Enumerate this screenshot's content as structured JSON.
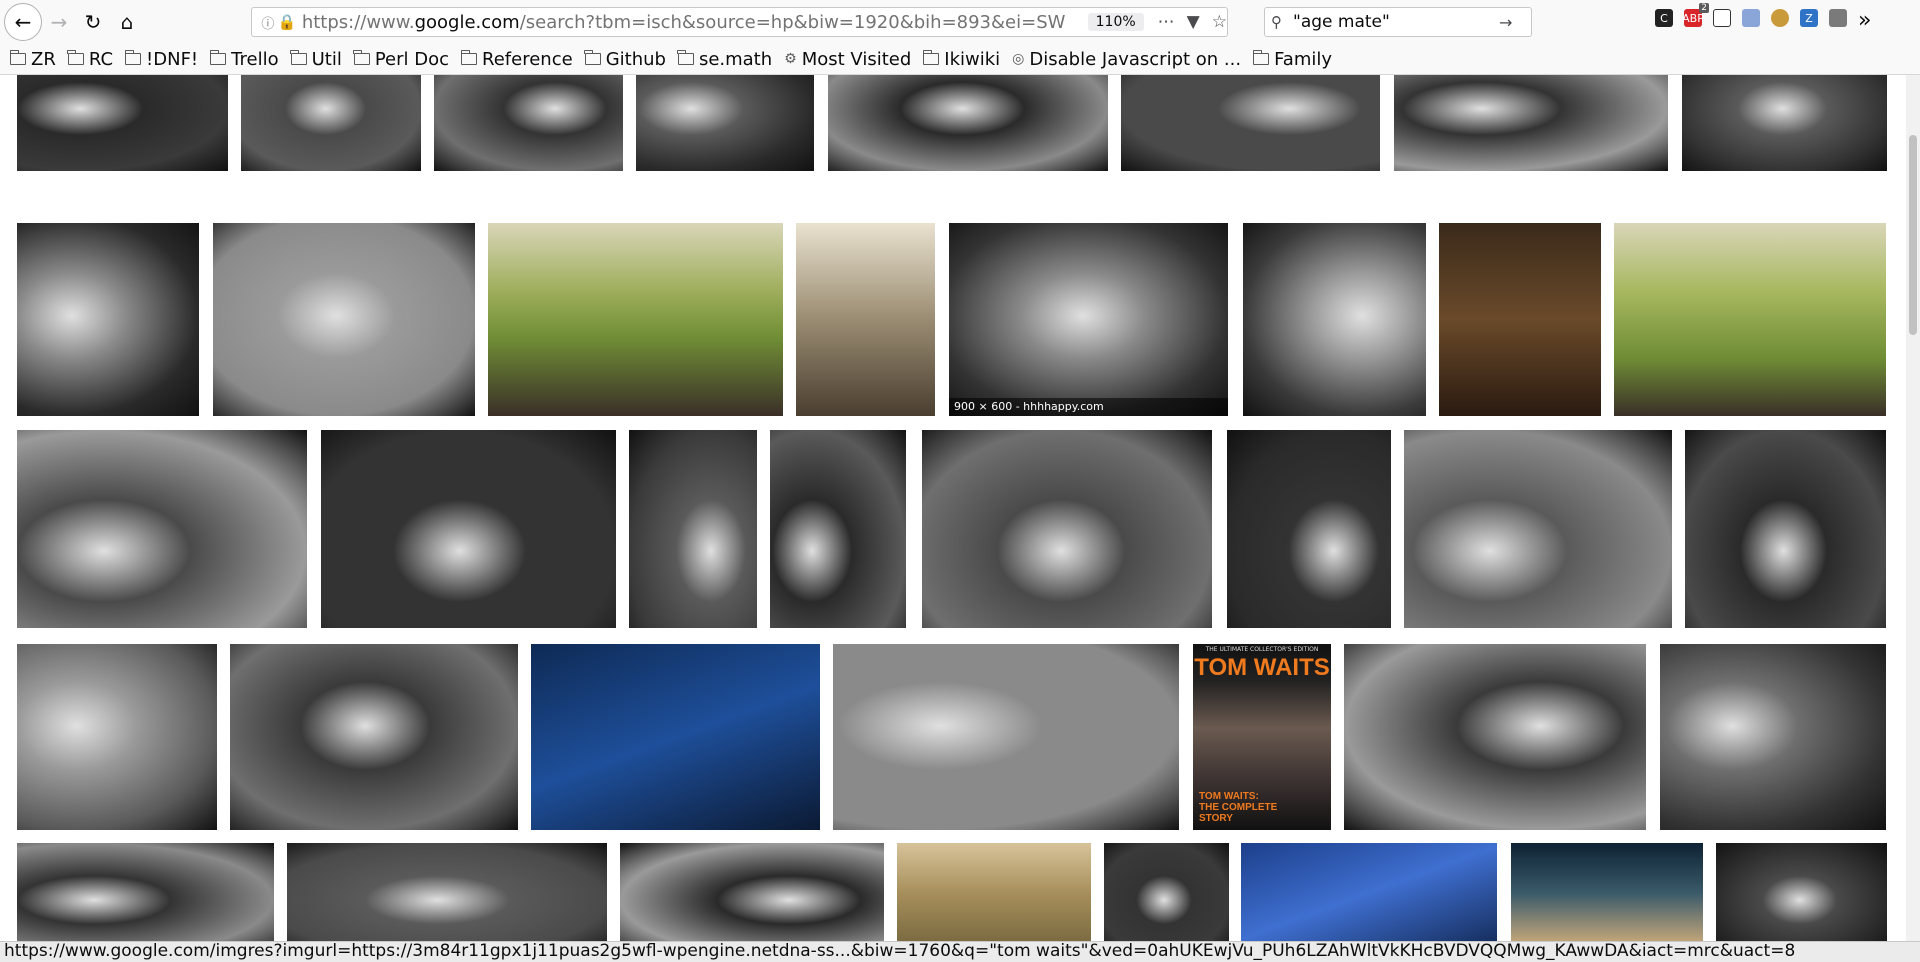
{
  "browser": {
    "url_scheme": "https://www.",
    "url_host": "google.com",
    "url_path": "/search?tbm=isch&source=hp&biw=1920&bih=893&ei=SW",
    "zoom": "110%",
    "search_query": "\"age mate\"",
    "extension_badge": "2"
  },
  "bookmarks": [
    {
      "label": "ZR",
      "icon": "folder-icon"
    },
    {
      "label": "RC",
      "icon": "folder-icon"
    },
    {
      "label": "!DNF!",
      "icon": "folder-icon"
    },
    {
      "label": "Trello",
      "icon": "folder-icon"
    },
    {
      "label": "Util",
      "icon": "folder-icon"
    },
    {
      "label": "Perl Doc",
      "icon": "folder-icon"
    },
    {
      "label": "Reference",
      "icon": "folder-icon"
    },
    {
      "label": "Github",
      "icon": "folder-icon"
    },
    {
      "label": "se.math",
      "icon": "folder-icon"
    },
    {
      "label": "Most Visited",
      "icon": "gear-icon"
    },
    {
      "label": "Ikiwiki",
      "icon": "folder-icon"
    },
    {
      "label": "Disable Javascript on ...",
      "icon": "globe-icon"
    },
    {
      "label": "Family",
      "icon": "folder-icon"
    }
  ],
  "results": {
    "hover_caption": "900 × 600 - hhhhappy.com",
    "magazine": {
      "top_line": "THE ULTIMATE COLLECTOR'S EDITION",
      "title": "TOM WAITS",
      "bottom_line": "TOM WAITS: THE COMPLETE STORY"
    }
  },
  "status_text": "https://www.google.com/imgres?imgurl=https://3m84r11gpx1j11puas2g5wfl-wpengine.netdna-ss...&biw=1760&q=\"tom waits\"&ved=0ahUKEwjVu_PUh6LZAhWltVkKHcBVDVQQMwg_KAwwDA&iact=mrc&uact=8"
}
